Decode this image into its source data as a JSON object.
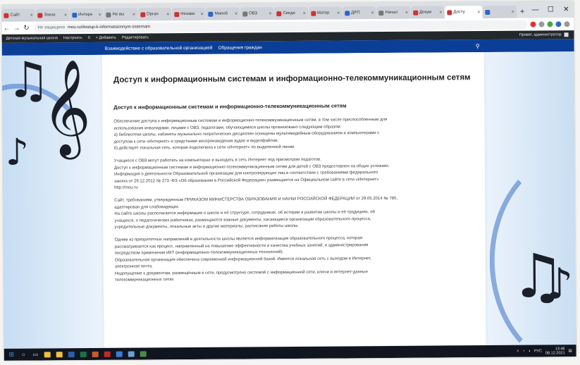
{
  "browser": {
    "tabs": [
      {
        "label": "Сайт",
        "icon": "site-favicon",
        "active": false
      },
      {
        "label": "Заказ",
        "icon": "site-favicon",
        "active": false
      },
      {
        "label": "Интерн",
        "icon": "site-favicon",
        "active": false
      },
      {
        "label": "Не вы",
        "icon": "site-favicon",
        "active": false
      },
      {
        "label": "Орган",
        "icon": "site-favicon",
        "active": false
      },
      {
        "label": "Незави",
        "icon": "site-favicon",
        "active": false
      },
      {
        "label": "Миноб",
        "icon": "site-favicon",
        "active": false
      },
      {
        "label": "ОВЗ",
        "icon": "site-favicon",
        "active": false
      },
      {
        "label": "Сведе",
        "icon": "site-favicon",
        "active": false
      },
      {
        "label": "Матер",
        "icon": "site-favicon",
        "active": false
      },
      {
        "label": "ДРП",
        "icon": "site-favicon",
        "active": false
      },
      {
        "label": "Начал",
        "icon": "site-favicon",
        "active": false
      },
      {
        "label": "Докум",
        "icon": "site-favicon",
        "active": false
      },
      {
        "label": "Досту",
        "icon": "site-favicon",
        "active": true
      },
      {
        "label": "",
        "icon": "site-favicon",
        "active": false
      }
    ],
    "new_tab_glyph": "+",
    "window_controls": {
      "minimize": "—",
      "maximize": "☐",
      "close": "✕"
    },
    "address": {
      "security_label": "Не защищено",
      "url": "mou.ru/dostup-k-informatsionnym-sistemam"
    }
  },
  "admin_bar": {
    "items": [
      "Детская музыкальная школа",
      "Настроить",
      "0",
      "+ Добавить",
      "Редактировать"
    ],
    "right_text": "Привет, администратор"
  },
  "site_nav": {
    "items": [
      "Взаимодействие с образовательной организацией",
      "Обращения граждан"
    ],
    "search_icon": "search-icon"
  },
  "page": {
    "title": "Доступ к информационным системам и информационно-телекоммуникационным сетям",
    "section_heading": "Доступ к информационным системам и информационно-телекоммуникационным сетям",
    "paragraphs": [
      [
        "Обеспечение доступа к информационным системам и информационно-телекоммуникационным сетям, в том числе приспособленным для",
        "использования инвалидами, лицами с ОВЗ, педагогами, обучающимися школы организовано следующим образом:",
        "а) библиотеки школы, кабинеты музыкально-теоретических дисциплин оснащены мультимедийным оборудованием и компьютерами с",
        "доступом к сети «Интернет» и средствами воспроизведения аудио и видеофайлов;",
        "б) действует локальная сеть, которая подключена к сети «Интернет» по выделенной линии."
      ],
      [
        "Учащиеся с ОВЗ могут работать на компьютерах и выходить в сеть Интернет под присмотром педагогов.",
        "Доступ к информационным системам и информационно-телекоммуникационным сетям для детей с ОВЗ предоставлен на общих условиях.",
        "Информация о деятельности Образовательной организации для контролирующих лиц в соответствии с требованиями федерального",
        "закона от 29.12.2012 № 273 -ФЗ «Об образовании в Российской Федерации» размещается на Официальном сайте в сети «Интернет»",
        "http://mou.ru"
      ],
      [
        "Сайт, требованиям, утвержденным ПРИКАЗОМ МИНИСТЕРСТВА ОБРАЗОВАНИЯ И НАУКИ РОССИЙСКОЙ ФЕДЕРАЦИИ от 29.05.2014 № 785,",
        "адаптирован для слабовидящих.",
        "На сайте школы располагается информация о школе и её структуре, сотрудниках, об истории и развитии школы и её традициях, об",
        "учащихся, о педагогических работниках, размещаются важные документы, касающиеся организации образовательного процесса,",
        "учредительные документы, локальные акты и другие материалы, расписание работы школы."
      ],
      [
        "Одним из приоритетных направлений в деятельности школы является информатизация образовательного процесса, которая",
        "рассматривается как процесс, направленный на повышение эффективности и качества учебных занятий, и администрирования",
        "посредством применения ИКТ (информационно-телекоммуникационных технологий).",
        "Образовательная организация обеспечена современной информационной базой. Имеется локальная сеть с выходом в Интернет,",
        "электронная почта.",
        "Недопущение к документам, размещённым в сети, предусмотрено системой с информационной сети, ключи и интернет-данные",
        "телекоммуникационных сетях"
      ]
    ]
  },
  "decorations": {
    "clef_glyph": "𝄞",
    "note_glyphs": [
      "♫",
      "♪",
      "♫",
      "♪"
    ]
  },
  "taskbar": {
    "start_glyph": "⊞",
    "search_glyph": "○",
    "taskview_glyph": "▭",
    "apps": [
      {
        "icon": "chrome-icon",
        "color": "#e8c040"
      },
      {
        "icon": "explorer-icon",
        "color": "#f0c040"
      },
      {
        "icon": "word-icon",
        "color": "#2b5faa"
      },
      {
        "icon": "excel-icon",
        "color": "#1e7145"
      },
      {
        "icon": "powerpoint-icon",
        "color": "#c85a2a"
      },
      {
        "icon": "acrobat-icon",
        "color": "#c02a2a"
      },
      {
        "icon": "mail-icon",
        "color": "#3b7bd4"
      },
      {
        "icon": "photos-icon",
        "color": "#6aa0d8"
      },
      {
        "icon": "app-icon",
        "color": "#4a8a4a"
      }
    ],
    "tray_text": "РУС",
    "time": "13:46",
    "date": "08.12.2021"
  },
  "colors": {
    "site_nav_bg": "#0b3f97",
    "admin_bar_bg": "#23282d",
    "taskbar_bg": "#10151f"
  }
}
